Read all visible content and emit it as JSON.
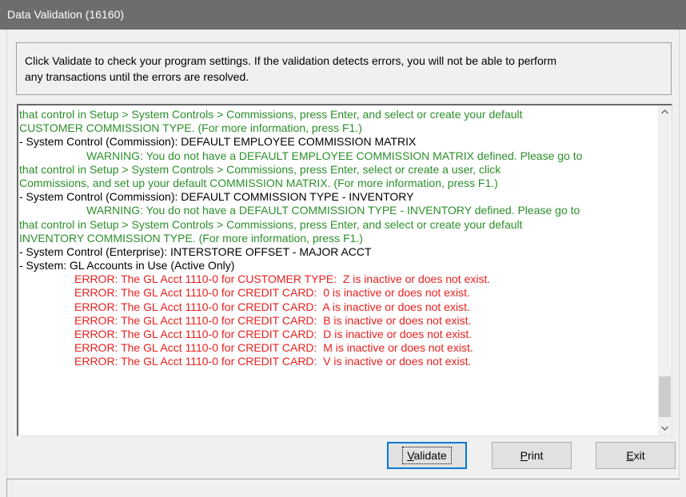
{
  "window": {
    "title": "Data Validation (16160)"
  },
  "instructions": {
    "line1": "Click Validate to check your program settings. If the validation detects errors, you will not be able to perform",
    "line2": "any transactions until the errors are resolved."
  },
  "results": {
    "lines": [
      {
        "text": "that control in Setup > System Controls > Commissions, press Enter, and select or create your default",
        "kind": "warning-cont"
      },
      {
        "text": "CUSTOMER COMMISSION TYPE. (For more information, press F1.)",
        "kind": "warning-cont"
      },
      {
        "text": "- System Control (Commission): DEFAULT EMPLOYEE COMMISSION MATRIX",
        "kind": "item"
      },
      {
        "text": "WARNING: You do not have a DEFAULT EMPLOYEE COMMISSION MATRIX defined. Please go to",
        "kind": "warning"
      },
      {
        "text": "that control in Setup > System Controls > Commissions, press Enter, select or create a user, click",
        "kind": "warning-cont"
      },
      {
        "text": "Commissions, and set up your default COMMISSION MATRIX. (For more information, press F1.)",
        "kind": "warning-cont"
      },
      {
        "text": "- System Control (Commission): DEFAULT COMMISSION TYPE - INVENTORY",
        "kind": "item"
      },
      {
        "text": "WARNING: You do not have a DEFAULT COMMISSION TYPE - INVENTORY defined. Please go to",
        "kind": "warning"
      },
      {
        "text": "that control in Setup > System Controls > Commissions, press Enter, and select or create your default",
        "kind": "warning-cont"
      },
      {
        "text": "INVENTORY COMMISSION TYPE. (For more information, press F1.)",
        "kind": "warning-cont"
      },
      {
        "text": "- System Control (Enterprise): INTERSTORE OFFSET - MAJOR ACCT",
        "kind": "item"
      },
      {
        "text": "- System: GL Accounts in Use (Active Only)",
        "kind": "item"
      },
      {
        "text": "ERROR: The GL Acct 1110-0 for CUSTOMER TYPE:  Z is inactive or does not exist.",
        "kind": "error"
      },
      {
        "text": "ERROR: The GL Acct 1110-0 for CREDIT CARD:  0 is inactive or does not exist.",
        "kind": "error"
      },
      {
        "text": "ERROR: The GL Acct 1110-0 for CREDIT CARD:  A is inactive or does not exist.",
        "kind": "error"
      },
      {
        "text": "ERROR: The GL Acct 1110-0 for CREDIT CARD:  B is inactive or does not exist.",
        "kind": "error"
      },
      {
        "text": "ERROR: The GL Acct 1110-0 for CREDIT CARD:  D is inactive or does not exist.",
        "kind": "error"
      },
      {
        "text": "ERROR: The GL Acct 1110-0 for CREDIT CARD:  M is inactive or does not exist.",
        "kind": "error"
      },
      {
        "text": "ERROR: The GL Acct 1110-0 for CREDIT CARD:  V is inactive or does not exist.",
        "kind": "error"
      }
    ]
  },
  "buttons": {
    "validate": {
      "label_underlined": "V",
      "label_rest": "alidate"
    },
    "print": {
      "label_underlined": "P",
      "label_rest": "rint"
    },
    "exit": {
      "label_underlined": "E",
      "label_rest": "xit"
    }
  },
  "colors": {
    "warning": "#2b8f2b",
    "item": "#000000",
    "error": "#e8201e",
    "titlebar": "#6d6d6d"
  },
  "icons": {
    "scroll_up": "chevron-up-icon",
    "scroll_down": "chevron-down-icon"
  }
}
